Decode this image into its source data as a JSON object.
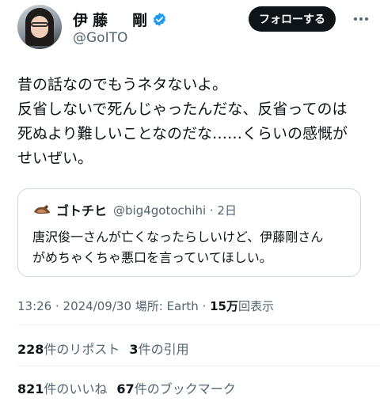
{
  "author": {
    "name": "伊藤　剛",
    "handle": "@GoITO",
    "verified": true
  },
  "header": {
    "follow_label": "フォローする"
  },
  "tweet": {
    "lines": [
      "昔の話なのでもうネタないよ。",
      "反省しないで死んじゃったんだな、反省ってのは",
      "死ぬより難しいことなのだな……くらいの感慨が",
      "せいぜい。"
    ]
  },
  "quote": {
    "name": "ゴトチヒ",
    "handle_time": "@big4gotochihi · 2日",
    "lines": [
      "唐沢俊一さんが亡くなったらしいけど、伊藤剛さん",
      "がめちゃくちゃ悪口を言っていてほしい。"
    ]
  },
  "meta": {
    "time_date_place": "13:26 · 2024/09/30 場所: Earth · ",
    "views_count": "15万",
    "views_label": "回表示"
  },
  "stats": {
    "reposts_count": "228",
    "reposts_label": "件のリポスト",
    "quotes_count": "3",
    "quotes_label": "件の引用",
    "likes_count": "821",
    "likes_label": "件のいいね",
    "bookmarks_count": "67",
    "bookmarks_label": "件のブックマーク"
  },
  "colors": {
    "verified_blue": "#1d9bf0",
    "follow_bg": "#0f1419",
    "secondary_text": "#536471",
    "border": "#cfd9de"
  },
  "icons": [
    "avatar",
    "verified-badge-icon",
    "more-icon",
    "quote-avatar"
  ]
}
